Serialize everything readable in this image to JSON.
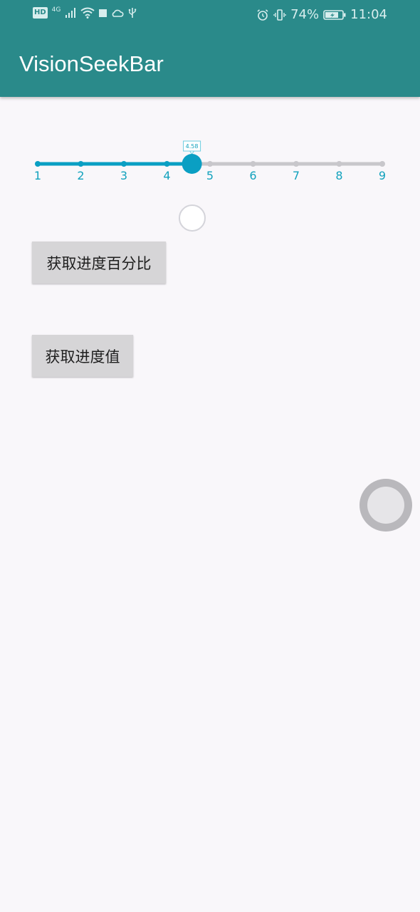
{
  "status_bar": {
    "left_icons": [
      "hd-icon",
      "network-4g-icon",
      "signal-icon",
      "wifi-icon",
      "notification-square-icon",
      "cloud-icon",
      "usb-icon"
    ],
    "hd_label": "HD",
    "network_label": "4G",
    "battery_percent": "74%",
    "time": "11:04"
  },
  "app_bar": {
    "title": "VisionSeekBar"
  },
  "seekbar": {
    "min": 1,
    "max": 9,
    "value": 4.58,
    "value_label": "4.58",
    "ticks": [
      "1",
      "2",
      "3",
      "4",
      "5",
      "6",
      "7",
      "8",
      "9"
    ],
    "active_color": "#0a9fc3",
    "inactive_color": "#c8c7cb",
    "tick_label_color": "#12a2bd"
  },
  "buttons": {
    "percent_label": "获取进度百分比",
    "value_label": "获取进度值"
  }
}
